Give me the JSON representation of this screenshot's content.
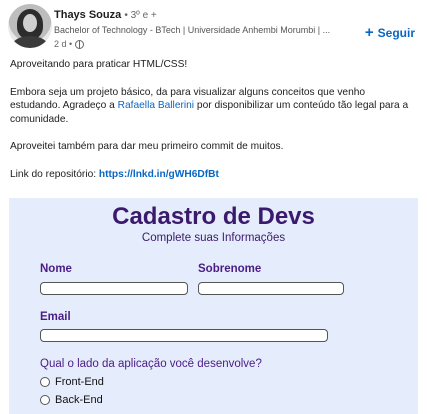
{
  "post": {
    "author_name": "Thays Souza",
    "author_degree": "• 3º e +",
    "headline": "Bachelor of Technology - BTech | Universidade Anhembi Morumbi | ...",
    "time": "2 d •",
    "follow_label": "Seguir",
    "paragraphs": {
      "p1": "Aproveitando para praticar HTML/CSS!",
      "p2_before": "Embora seja um projeto básico, da para visualizar alguns conceitos que venho estudando. Agradeço a ",
      "p2_mention": "Rafaella Ballerini",
      "p2_after": " por disponibilizar um conteúdo tão legal para a comunidade.",
      "p3": "Aproveitei também para dar meu primeiro commit de muitos.",
      "p4_label": "Link do repositório: ",
      "p4_link": "https://lnkd.in/gWH6DfBt"
    }
  },
  "preview": {
    "title": "Cadastro de Devs",
    "subtitle": "Complete suas Informações",
    "nome_label": "Nome",
    "sobrenome_label": "Sobrenome",
    "email_label": "Email",
    "question": "Qual o lado da aplicação você desenvolve?",
    "options": [
      "Front-End",
      "Back-End"
    ]
  },
  "colors": {
    "accent": "#0a66c2",
    "form_title": "#3b1a6e",
    "form_bg": "#e5ecfb"
  }
}
